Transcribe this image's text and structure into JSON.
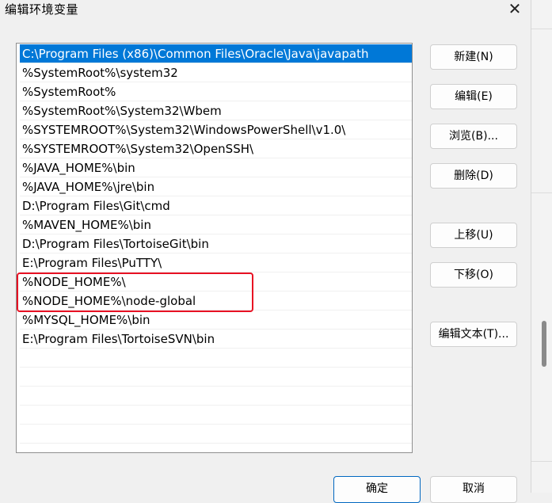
{
  "window": {
    "title": "编辑环境变量",
    "close_glyph": "✕"
  },
  "paths": [
    "C:\\Program Files (x86)\\Common Files\\Oracle\\Java\\javapath",
    "%SystemRoot%\\system32",
    "%SystemRoot%",
    "%SystemRoot%\\System32\\Wbem",
    "%SYSTEMROOT%\\System32\\WindowsPowerShell\\v1.0\\",
    "%SYSTEMROOT%\\System32\\OpenSSH\\",
    "%JAVA_HOME%\\bin",
    "%JAVA_HOME%\\jre\\bin",
    "D:\\Program Files\\Git\\cmd",
    "%MAVEN_HOME%\\bin",
    "D:\\Program Files\\TortoiseGit\\bin",
    "E:\\Program Files\\PuTTY\\",
    "%NODE_HOME%\\",
    "%NODE_HOME%\\node-global",
    "%MYSQL_HOME%\\bin",
    "E:\\Program Files\\TortoiseSVN\\bin"
  ],
  "selected_index": 0,
  "buttons": {
    "new": "新建(N)",
    "edit": "编辑(E)",
    "browse": "浏览(B)...",
    "delete": "删除(D)",
    "move_up": "上移(U)",
    "move_down": "下移(O)",
    "edit_text": "编辑文本(T)...",
    "ok": "确定",
    "cancel": "取消"
  },
  "colors": {
    "selection": "#0078d7",
    "annotation": "#e81123"
  }
}
